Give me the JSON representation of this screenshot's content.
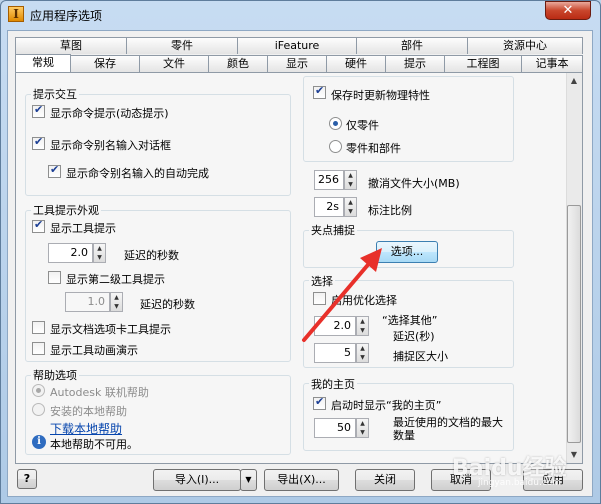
{
  "window": {
    "title": "应用程序选项",
    "app_icon_glyph": "I",
    "close_glyph": "✕"
  },
  "tabs_row1": [
    "草图",
    "零件",
    "iFeature",
    "部件",
    "资源中心"
  ],
  "tabs_row2": [
    "常规",
    "保存",
    "文件",
    "颜色",
    "显示",
    "硬件",
    "提示",
    "工程图",
    "记事本"
  ],
  "active_tab": "常规",
  "prompt_interaction": {
    "title": "提示交互",
    "show_command_prompts": {
      "label": "显示命令提示(动态提示)",
      "checked": true
    },
    "show_command_alias_dialog": {
      "label": "显示命令别名输入对话框",
      "checked": true
    },
    "show_alias_autocomplete": {
      "label": "显示命令别名输入的自动完成",
      "checked": true
    }
  },
  "tooltip_appearance": {
    "title": "工具提示外观",
    "show_tooltips": {
      "label": "显示工具提示",
      "checked": true
    },
    "delay_value": "2.0",
    "delay_label": "延迟的秒数",
    "show_second_level": {
      "label": "显示第二级工具提示",
      "checked": false
    },
    "second_delay_value": "1.0",
    "second_delay_label": "延迟的秒数",
    "show_doc_tab_tooltips": {
      "label": "显示文档选项卡工具提示",
      "checked": false
    },
    "show_tool_animation": {
      "label": "显示工具动画演示",
      "checked": false
    }
  },
  "help_options": {
    "title": "帮助选项",
    "autodesk_online": "Autodesk 联机帮助",
    "local_help": "安装的本地帮助",
    "download_link": "下载本地帮助",
    "unavailable_note": "本地帮助不可用。"
  },
  "physics": {
    "update_on_save": {
      "label": "保存时更新物理特性",
      "checked": true
    },
    "parts_only": {
      "label": "仅零件",
      "selected": true
    },
    "parts_and_assemblies": {
      "label": "零件和部件",
      "selected": false
    }
  },
  "undo_file_size": {
    "value": "256",
    "label": "撤消文件大小(MB)"
  },
  "annotation_scale": {
    "value": "2s",
    "label": "标注比例"
  },
  "grip_snap": {
    "title": "夹点捕捉",
    "options_button": "选项..."
  },
  "selection": {
    "title": "选择",
    "enable_optimized": {
      "label": "启用优化选择",
      "checked": false
    },
    "select_other_label": "“选择其他”",
    "delay_label": "延迟(秒)",
    "delay_value": "2.0",
    "pick_box_label": "捕捉区大小",
    "pick_box_value": "5"
  },
  "my_home": {
    "title": "我的主页",
    "show_on_start": {
      "label": "启动时显示“我的主页”",
      "checked": true
    },
    "recent_docs_value": "50",
    "recent_docs_label_line1": "最近使用的文档的最大",
    "recent_docs_label_line2": "数量"
  },
  "footer": {
    "help_glyph": "?",
    "import_button": "导入(I)...",
    "export_button": "导出(X)...",
    "close_button": "关闭",
    "cancel_button": "取消",
    "apply_button": "应用"
  },
  "watermark": {
    "text": "Baidu经验",
    "sub": "jingyan.baidu.com"
  }
}
